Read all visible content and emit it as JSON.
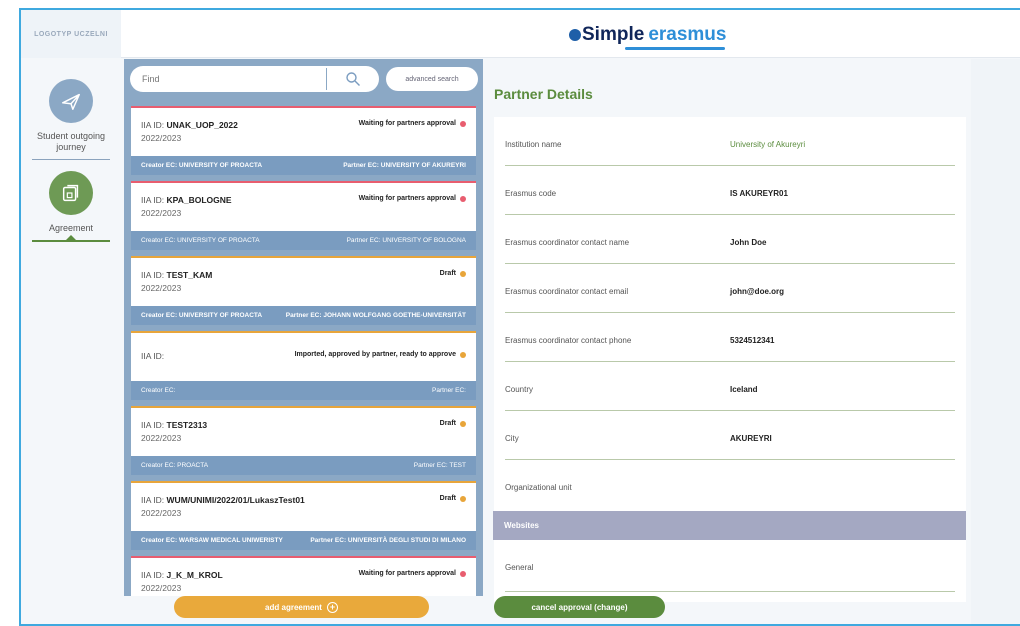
{
  "header": {
    "logo_placeholder": "LOGOTYP UCZELNI",
    "brand_part1": "Simple",
    "brand_part2": "erasmus"
  },
  "sidebar": {
    "items": [
      {
        "label": "Student outgoing journey",
        "icon": "plane-icon",
        "color": "#8ba8c5"
      },
      {
        "label": "Agreement",
        "icon": "documents-icon",
        "color": "#6e9a55"
      }
    ]
  },
  "search": {
    "placeholder": "Find",
    "advanced_label": "advanced search"
  },
  "agreements": [
    {
      "iia_label": "IIA ID:",
      "iia": "UNAK_UOP_2022",
      "year": "2022/2023",
      "status": "Waiting for partners approval",
      "status_color": "red",
      "creator": "Creator EC: UNIVERSITY OF PROACTA",
      "partner": "Partner EC: UNIVERSITY OF AKUREYRI"
    },
    {
      "iia_label": "IIA ID:",
      "iia": "KPA_BOLOGNE",
      "year": "2022/2023",
      "status": "Waiting for partners approval",
      "status_color": "red",
      "creator": "Creator EC: UNIVERSITY OF PROACTA",
      "partner": "Partner EC: UNIVERSITY OF BOLOGNA"
    },
    {
      "iia_label": "IIA ID:",
      "iia": "TEST_KAM",
      "year": "2022/2023",
      "status": "Draft",
      "status_color": "orange",
      "creator": "Creator EC: UNIVERSITY OF PROACTA",
      "partner": "Partner EC: JOHANN WOLFGANG GOETHE-UNIVERSITÄT"
    },
    {
      "iia_label": "IIA ID:",
      "iia": "",
      "year": "",
      "status": "Imported, approved by partner, ready to approve",
      "status_color": "orange",
      "creator": "Creator EC:",
      "partner": "Partner EC:"
    },
    {
      "iia_label": "IIA ID:",
      "iia": "TEST2313",
      "year": "2022/2023",
      "status": "Draft",
      "status_color": "orange",
      "creator": "Creator EC: PROACTA",
      "partner": "Partner EC: TEST"
    },
    {
      "iia_label": "IIA ID:",
      "iia": "WUM/UNIMI/2022/01/LukaszTest01",
      "year": "2022/2023",
      "status": "Draft",
      "status_color": "orange",
      "creator": "Creator EC: WARSAW MEDICAL UNIWERISTY",
      "partner": "Partner EC: UNIVERSITÀ DEGLI STUDI DI MILANO"
    },
    {
      "iia_label": "IIA ID:",
      "iia": "J_K_M_KROL",
      "year": "2022/2023",
      "status": "Waiting for partners approval",
      "status_color": "red",
      "creator": "",
      "partner": ""
    }
  ],
  "add_button": "add agreement",
  "details": {
    "title": "Partner Details",
    "rows": [
      {
        "label": "Institution name",
        "value": "University of Akureyri",
        "green": true
      },
      {
        "label": "Erasmus code",
        "value": "IS AKUREYR01"
      },
      {
        "label": "Erasmus coordinator contact name",
        "value": "John Doe"
      },
      {
        "label": "Erasmus coordinator contact email",
        "value": "john@doe.org"
      },
      {
        "label": "Erasmus coordinator contact phone",
        "value": "5324512341"
      },
      {
        "label": "Country",
        "value": "Iceland"
      },
      {
        "label": "City",
        "value": "AKUREYRI"
      },
      {
        "label": "Organizational unit",
        "value": ""
      }
    ],
    "websites_header": "Websites",
    "general_label": "General"
  },
  "cancel_button": "cancel approval (change)"
}
